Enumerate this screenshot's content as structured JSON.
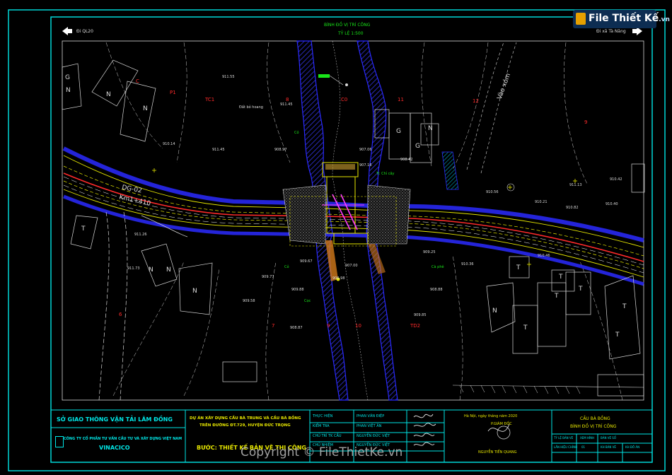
{
  "watermark": {
    "logo_text": "File Thiết Kế",
    "logo_suffix": ".vn",
    "copyright": "Copyright © FileThietKe.vn"
  },
  "header": {
    "title": "BÌNH ĐỒ VỊ TRÍ CÔNG",
    "scale": "TỶ LỆ 1:500",
    "left_direction": "Đi QL20",
    "right_direction": "Đi xã Tà Năng"
  },
  "map_labels": {
    "station_left": "DG-02",
    "station_km": "Km1+410",
    "road_to_village": "Vào xóm",
    "stakes": [
      "TC1",
      "8",
      "C0",
      "11",
      "12",
      "P1",
      "C",
      "TD2",
      "7",
      "9",
      "10",
      "6",
      "9"
    ],
    "house_letters": [
      "N",
      "N",
      "N",
      "G",
      "G",
      "G",
      "N",
      "T",
      "N",
      "N",
      "N",
      "T",
      "T",
      "T",
      "T",
      "T",
      "T",
      "N",
      "T"
    ],
    "elevations": [
      "911.55",
      "911.45",
      "911.45",
      "910.14",
      "908.97",
      "907.06",
      "907.16",
      "908.42",
      "910.56",
      "910.21",
      "910.82",
      "911.13",
      "910.42",
      "910.40",
      "909.25",
      "909.77",
      "909.88",
      "909.67",
      "907.00",
      "906.98",
      "909.58",
      "908.87",
      "909.85",
      "908.88",
      "910.46",
      "910.36",
      "911.73",
      "911.26"
    ],
    "annotations": [
      "Đất bỏ hoang",
      "Cà phê",
      "Cỏ",
      "Tr. Chỉ cây",
      "Cỏ",
      "Cọc"
    ]
  },
  "title_block": {
    "agency": "SỞ GIAO THÔNG VẬN TẢI LÂM ĐỒNG",
    "company": "CÔNG TY CỔ PHẦN TƯ VẤN CẦU TƯ VÀ XÂY DỰNG VIỆT NAM",
    "company_short": "VINACICO",
    "project_line1": "DỰ ÁN XÂY DỰNG CẦU BÀ TRUNG VÀ CẦU BÀ BỒNG",
    "project_line2": "TRÊN ĐƯỜNG ĐT.729, HUYỆN ĐỨC TRỌNG",
    "stage": "BƯỚC: THIẾT KẾ BẢN VẼ THI CÔNG",
    "roles": [
      {
        "role": "THỰC HIỆN",
        "name": "PHAN VĂN ĐIỆP"
      },
      {
        "role": "KIỂM TRA",
        "name": "PHAN VIỆT ÂN"
      },
      {
        "role": "CHỦ TRÌ TK CẦU",
        "name": "NGUYỄN ĐỨC VIỆT"
      },
      {
        "role": "CHỦ NHIỆM",
        "name": "NGUYỄN ĐỨC VIỆT"
      }
    ],
    "date_line": "Hà Nội, ngày    tháng    năm 2020",
    "director_title": "P.GIÁM ĐỐC",
    "director_name": "NGUYỄN TIẾN QUANG",
    "drawing_name_1": "CẦU BÀ BỒNG",
    "drawing_name_2": "BÌNH ĐỒ VỊ TRÍ CÔNG",
    "meta": [
      {
        "label": "TỶ LỆ BẢN VẼ",
        "value": "XEM HÌNH"
      },
      {
        "label": "BẢN VẼ SỐ",
        "value": ""
      },
      {
        "label": "LẦN HIỆU CHỈNH",
        "value": "01"
      },
      {
        "label": "KH BẢN VẼ",
        "value": ""
      },
      {
        "label": "KH ĐỒ ÁN",
        "value": ""
      }
    ]
  },
  "colors": {
    "frame": "#00e6e6",
    "road_centerline": "#ff2a2a",
    "road_edge": "#e6e600",
    "river_bank": "#2222ff",
    "contour": "#d8d8d8",
    "text_green": "#19e619"
  }
}
